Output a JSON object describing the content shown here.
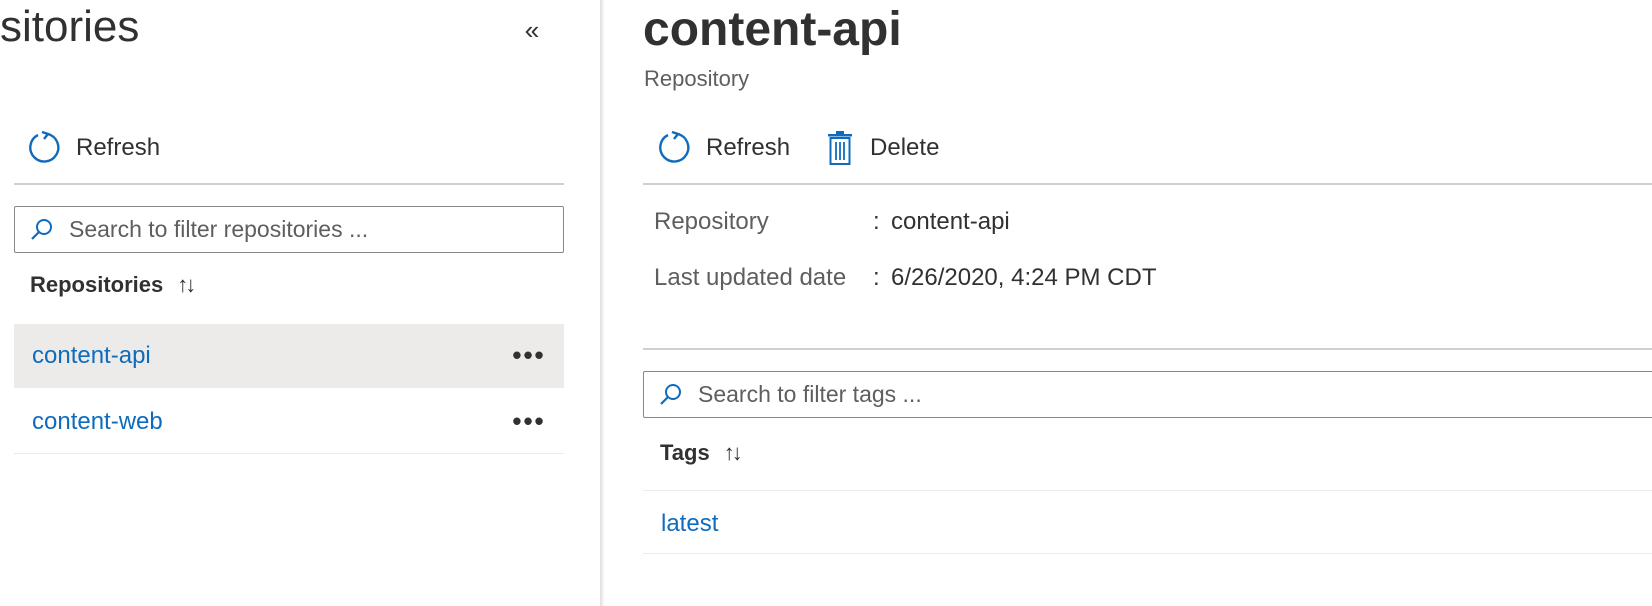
{
  "left_pane": {
    "title": "sitories",
    "collapse_glyph": "«",
    "toolbar": {
      "refresh_label": "Refresh"
    },
    "search": {
      "placeholder": "Search to filter repositories ..."
    },
    "column_header": "Repositories",
    "sort_glyph": "↑↓",
    "repositories": [
      {
        "name": "content-api",
        "selected": true,
        "more": "•••"
      },
      {
        "name": "content-web",
        "selected": false,
        "more": "•••"
      }
    ]
  },
  "right_pane": {
    "title": "content-api",
    "subtitle": "Repository",
    "toolbar": {
      "refresh_label": "Refresh",
      "delete_label": "Delete"
    },
    "properties": [
      {
        "label": "Repository",
        "colon": ":",
        "value": "content-api"
      },
      {
        "label": "Last updated date",
        "colon": ":",
        "value": "6/26/2020, 4:24 PM CDT"
      }
    ],
    "search": {
      "placeholder": "Search to filter tags ..."
    },
    "column_header": "Tags",
    "sort_glyph": "↑↓",
    "tags": [
      {
        "name": "latest"
      }
    ]
  },
  "colors": {
    "accent": "#0f6cbd",
    "text": "#323130",
    "muted": "#605e5c",
    "selected_row": "#edebe9",
    "separator": "#d2d0ce"
  },
  "icons": [
    "refresh-icon",
    "delete-icon",
    "search-icon",
    "collapse-icon",
    "sort-icon",
    "more-icon"
  ]
}
